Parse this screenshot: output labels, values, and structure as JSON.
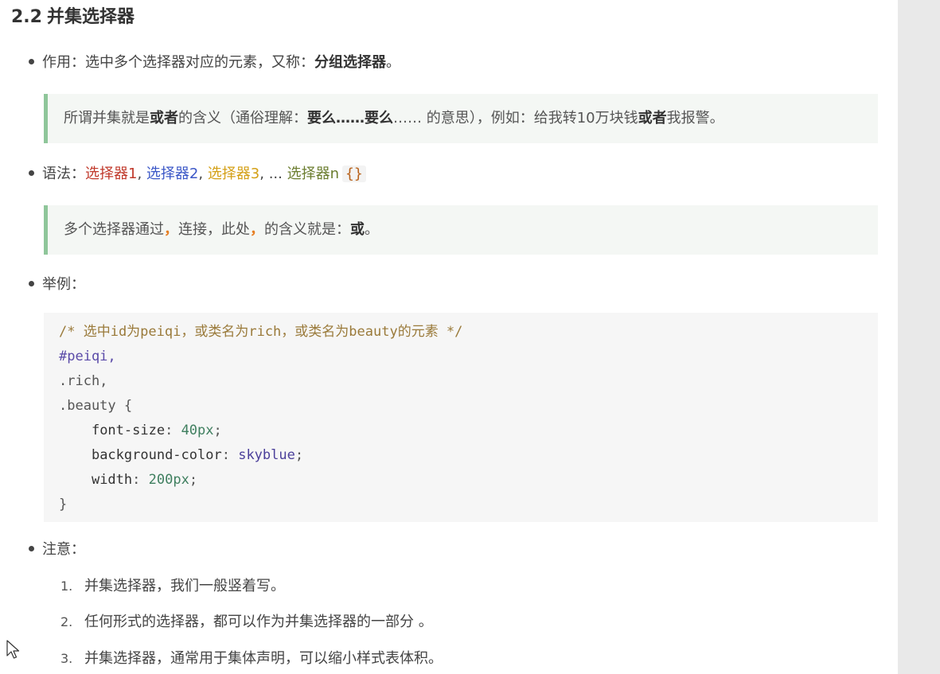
{
  "section": {
    "number": "2.2",
    "title": "并集选择器"
  },
  "bullets": {
    "usage": {
      "prefix": "作用：选中多个选择器对应的元素，又称：",
      "strong": "分组选择器",
      "suffix": "。"
    },
    "syntax": {
      "prefix": "语法：",
      "sel1": "选择器1",
      "sep1": ", ",
      "sel2": "选择器2",
      "sep2": ", ",
      "sel3": "选择器3",
      "sep3": ", ... ",
      "seln": "选择器n",
      "brace": "{}"
    },
    "example": "举例：",
    "notes": "注意："
  },
  "quote1": {
    "p1": "所谓并集就是",
    "s1": "或者",
    "p2": "的含义（通俗理解：",
    "s2": "要么",
    "p3": "……",
    "s3": "要么",
    "p4": "…… 的意思），例如：给我转10万块钱",
    "s4": "或者",
    "p5": "我报警。"
  },
  "quote2": {
    "p1": "多个选择器通过",
    "comma1": "，",
    "p2": "连接，此处",
    "comma2": "，",
    "p3": "的含义就是：",
    "strong": "或",
    "p4": "。"
  },
  "code": {
    "line1": "/* 选中id为peiqi，或类名为rich，或类名为beauty的元素 */",
    "line2": "#peiqi,",
    "line3": ".rich,",
    "line4": ".beauty {",
    "line5_prop": "font-size",
    "line5_val": "40px",
    "line6_prop": "background-color",
    "line6_val": "skyblue",
    "line7_prop": "width",
    "line7_val": "200px",
    "line8": "}"
  },
  "notes_list": [
    {
      "num": "1.",
      "text": "并集选择器，我们一般竖着写。"
    },
    {
      "num": "2.",
      "text": "任何形式的选择器，都可以作为并集选择器的一部分 。"
    },
    {
      "num": "3.",
      "text": "并集选择器，通常用于集体声明，可以缩小样式表体积。"
    }
  ]
}
